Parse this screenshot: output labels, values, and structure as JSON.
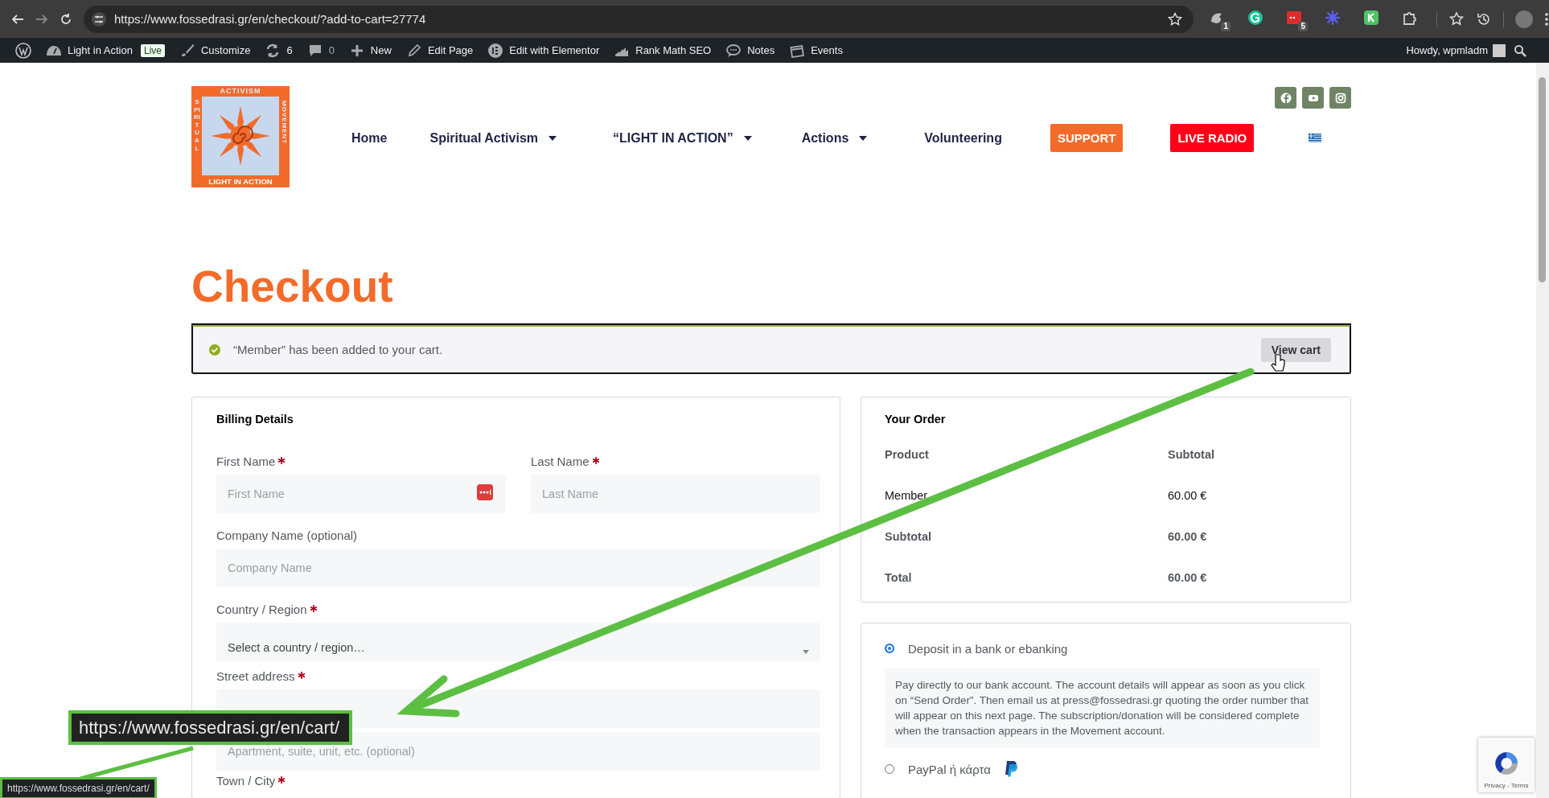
{
  "browser": {
    "url": "https://www.fossedrasi.gr/en/checkout/?add-to-cart=27774",
    "extensions": [
      {
        "kind": "bird",
        "badge": "1"
      },
      {
        "kind": "g-circle"
      },
      {
        "kind": "red-square",
        "badge": "5"
      },
      {
        "kind": "burst"
      },
      {
        "kind": "k-square"
      },
      {
        "kind": "puzzle"
      }
    ]
  },
  "admin_bar": {
    "items": [
      {
        "kind": "wordpress"
      },
      {
        "kind": "dashboard",
        "label": "Light in Action",
        "badge": "Live"
      },
      {
        "kind": "brush",
        "label": "Customize"
      },
      {
        "kind": "updates",
        "label": "6"
      },
      {
        "kind": "comments",
        "label": "0"
      },
      {
        "kind": "plus",
        "label": "New"
      },
      {
        "kind": "pencil",
        "label": "Edit Page"
      },
      {
        "kind": "elementor",
        "label": "Edit with Elementor"
      },
      {
        "kind": "chart",
        "label": "Rank Math SEO"
      },
      {
        "kind": "speech",
        "label": "Notes"
      },
      {
        "kind": "calendar",
        "label": "Events"
      }
    ],
    "account": "Howdy, wpmladm"
  },
  "header": {
    "logo": {
      "top": "ACTIVISM",
      "left": "SPIRITUAL",
      "right": "MOVEMENT",
      "bottom": "LIGHT IN ACTION"
    },
    "social": [
      {
        "kind": "facebook"
      },
      {
        "kind": "youtube"
      },
      {
        "kind": "instagram"
      }
    ],
    "nav": [
      {
        "kind": "link",
        "label": "Home",
        "dropdown": false
      },
      {
        "kind": "link",
        "label": "Spiritual Activism",
        "dropdown": true
      },
      {
        "kind": "link",
        "label": "“LIGHT IN ACTION”",
        "dropdown": true
      },
      {
        "kind": "link",
        "label": "Actions",
        "dropdown": true
      },
      {
        "kind": "link",
        "label": "Volunteering",
        "dropdown": false
      },
      {
        "kind": "button",
        "label": "SUPPORT",
        "color": "#f26b2a"
      },
      {
        "kind": "button",
        "label": "LIVE RADIO",
        "color": "#ff0019"
      },
      {
        "kind": "flag"
      }
    ]
  },
  "page_title": "Checkout",
  "notice": {
    "text": "“Member” has been added to your cart.",
    "button": "View cart"
  },
  "billing": {
    "title": "Billing Details",
    "rows": [
      [
        {
          "label": "First Name",
          "required": true,
          "kind": "text",
          "placeholder": "First Name",
          "autofill_icon": true
        },
        {
          "label": "Last Name",
          "required": true,
          "kind": "text",
          "placeholder": "Last Name"
        }
      ],
      [
        {
          "label": "Company Name (optional)",
          "required": false,
          "kind": "text",
          "placeholder": "Company Name"
        }
      ],
      [
        {
          "label": "Country / Region",
          "required": true,
          "kind": "select",
          "value": "Select a country / region…"
        }
      ],
      [
        {
          "label": "Street address",
          "required": true,
          "kind": "text"
        }
      ],
      [
        {
          "kind": "text",
          "placeholder": "Apartment, suite, unit, etc. (optional)"
        }
      ],
      [
        {
          "label": "Town / City",
          "required": true
        }
      ]
    ]
  },
  "order": {
    "title": "Your Order",
    "columns": [
      "Product",
      "Subtotal"
    ],
    "rows": [
      {
        "kind": "item",
        "cells": [
          "Member",
          "60.00 €"
        ]
      },
      {
        "kind": "total",
        "cells": [
          "Subtotal",
          "60.00 €"
        ]
      },
      {
        "kind": "total",
        "cells": [
          "Total",
          "60.00 €"
        ]
      }
    ]
  },
  "payment": {
    "methods": [
      {
        "label": "Deposit in a bank or ebanking",
        "selected": true,
        "description": "Pay directly to our bank account. The account details will appear as soon as you click on “Send Order”. Then email us at press@fossedrasi.gr quoting the order number that will appear on this next page. The subscription/donation will be considered complete when the transaction appears in the Movement account."
      },
      {
        "kind": "paypal",
        "label": "PayPal ή κάρτα",
        "selected": false
      }
    ]
  },
  "recaptcha": {
    "links": "Privacy - Terms"
  },
  "status_url": "https://www.fossedrasi.gr/en/cart/",
  "annotation": {
    "zoomed_url": "https://www.fossedrasi.gr/en/cart/"
  }
}
